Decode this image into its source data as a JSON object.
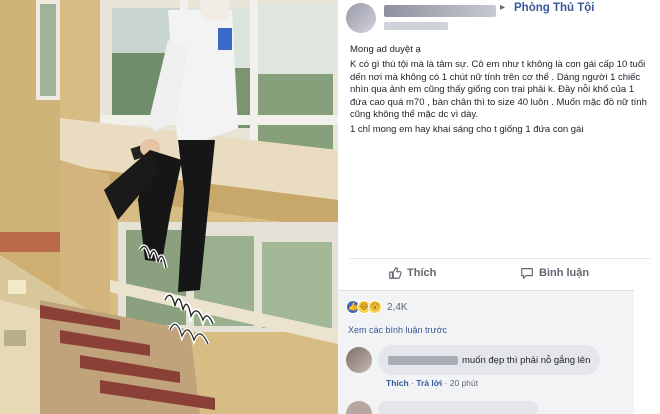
{
  "post": {
    "group_arrow": "▸",
    "group_name": "Phòng Thủ Tội",
    "paragraphs": [
      "Mong ad duyệt ạ",
      "K có gì thú tội mà là tâm sự. Cô em như t không là con gái cấp 10 tuổi dến nơi mà không có 1 chút nữ tính trên cơ thể . Dáng người 1 chiếc nhìn qua ảnh em cũng thấy giống con trai phải k. Đầy nỗi khổ của 1 đứa cao quá m70 , bàn chân thì to size 40 luôn . Muốn mặc đồ nữ tính cũng không thể mặc dc vì dày.",
      "1 chỉ mong em hay khai sáng cho t giống 1 đứa con gái"
    ]
  },
  "actions": {
    "like_label": "Thích",
    "comment_label": "Bình luận"
  },
  "reactions": {
    "count": "2,4K"
  },
  "comments": {
    "more_label": "Xem các bình luận trước",
    "first": {
      "text": "muốn đẹp thì phải nỗ gắng lên",
      "like_label": "Thích",
      "reply_label": "Trả lời",
      "time": "20 phút"
    }
  },
  "icons": {
    "like": "thumbs-up-icon",
    "comment": "speech-bubble-icon",
    "reaction_like": "like-reaction-icon",
    "reaction_haha": "haha-reaction-icon",
    "reaction_wow": "wow-reaction-icon"
  },
  "colors": {
    "link_blue": "#385898",
    "like_blue": "#4267b2",
    "text_dark": "#1d2129",
    "text_gray": "#606770",
    "comment_bg": "#f2f3f5"
  }
}
